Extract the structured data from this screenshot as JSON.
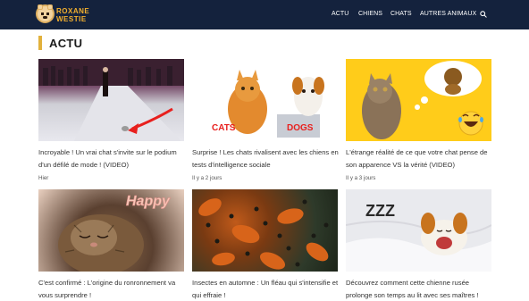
{
  "site": {
    "logo_line1": "ROXANE",
    "logo_line2": "WESTIE",
    "header_bg": "#14223d",
    "accent": "#e2b13c"
  },
  "nav": {
    "items": [
      {
        "label": "ACTU"
      },
      {
        "label": "CHIENS"
      },
      {
        "label": "CHATS"
      },
      {
        "label": "AUTRES ANIMAUX"
      }
    ],
    "search_icon": "search-icon"
  },
  "section": {
    "title": "ACTU"
  },
  "articles": [
    {
      "title": "Incroyable ! Un vrai chat s'invite sur le podium d'un défilé de mode ! (VIDEO)",
      "date": "Hier",
      "image": "cat on fashion runway with red arrow"
    },
    {
      "title": "Surprise ! Les chats rivalisent avec les chiens en tests d'intelligence sociale",
      "date": "Il y a 2 jours",
      "image": "cat and dog with laptop",
      "image_labels": [
        "CATS",
        "DOGS"
      ]
    },
    {
      "title": "L'étrange réalité de ce que votre chat pense de son apparence VS la vérité (VIDEO)",
      "date": "Il y a 3 jours",
      "image": "cat imagining lion with laughing emoji"
    },
    {
      "title": "C'est confirmé : L'origine du ronronnement va vous surprendre !",
      "date": "",
      "image": "sleeping tabby cat",
      "image_labels": [
        "Happy"
      ]
    },
    {
      "title": "Insectes en automne : Un fléau qui s'intensifie et qui effraie !",
      "date": "",
      "image": "swarm of ladybugs on autumn leaves"
    },
    {
      "title": "Découvrez comment cette chienne rusée prolonge son temps au lit avec ses maîtres !",
      "date": "",
      "image": "jack russell dog yawning in bed",
      "image_labels": [
        "ZZZ"
      ]
    }
  ]
}
